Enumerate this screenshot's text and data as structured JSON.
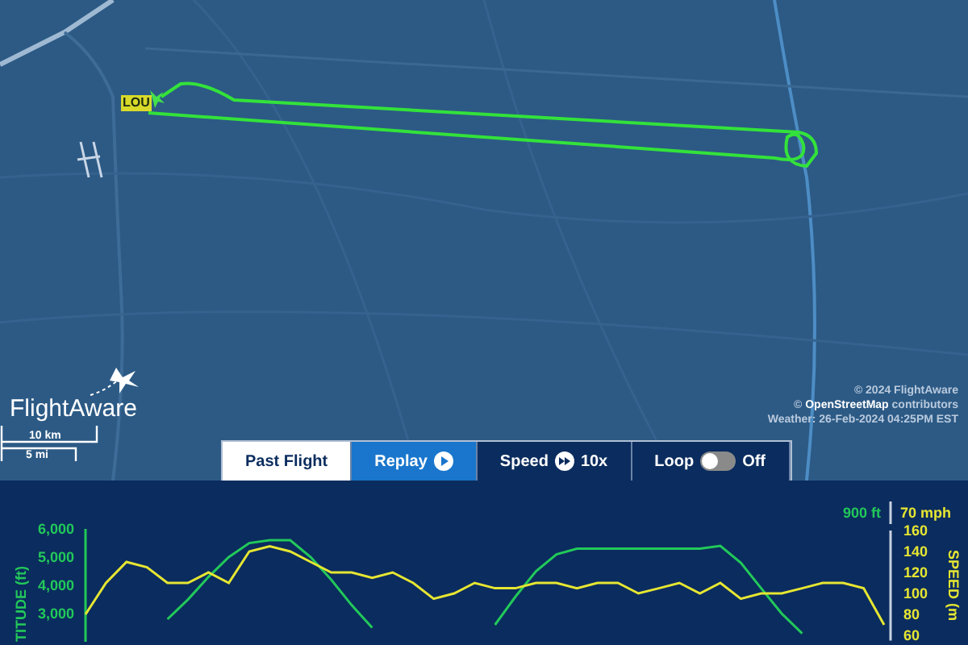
{
  "map": {
    "kind": "picture",
    "airport_label": "LOU",
    "logo": "FlightAware",
    "scale": [
      "10 km",
      "5 mi"
    ],
    "attribution": [
      "© 2024 FlightAware",
      "© **OpenStreetMap** contributors",
      "Weather: 26-Feb-2024 04:25PM EST"
    ]
  },
  "toolbar": [
    {
      "kind": "tab",
      "label": "Past Flight",
      "selected": true
    },
    {
      "kind": "play",
      "label": "Replay",
      "selected": false
    },
    {
      "kind": "speed",
      "label": "Speed",
      "value": "10x",
      "selected": false
    },
    {
      "kind": "toggle",
      "label": "Loop",
      "on": false,
      "value": "Off",
      "selected": false
    }
  ],
  "chart": {
    "left_reading": "900 ft",
    "right_reading": "70 mph",
    "chart_data": {
      "type": "line",
      "ylabel": "TITUDE (ft)",
      "y2label": "SPEED (m",
      "series": [
        {
          "color": "#22c95a",
          "values": [
            null,
            null,
            null,
            null,
            2800,
            3500,
            4300,
            5000,
            5500,
            5600,
            5600,
            5000,
            4200,
            3300,
            2500,
            null,
            null,
            null,
            null,
            null,
            2600,
            3600,
            4500,
            5100,
            5300,
            5300,
            5300,
            5300,
            5300,
            5300,
            5300,
            5400,
            4800,
            3900,
            3000,
            2300,
            null,
            null,
            null,
            null
          ]
        },
        {
          "color": "#e6e632",
          "axis": "y2",
          "values": [
            80,
            110,
            130,
            125,
            110,
            110,
            120,
            110,
            140,
            145,
            140,
            130,
            120,
            120,
            115,
            120,
            110,
            95,
            100,
            110,
            105,
            105,
            110,
            110,
            105,
            110,
            110,
            100,
            105,
            110,
            100,
            110,
            95,
            100,
            100,
            105,
            110,
            110,
            105,
            70
          ]
        }
      ],
      "ylim": [
        2000,
        6000
      ],
      "y2lim": [
        55,
        160
      ],
      "yticks": [
        {
          "value": 3000,
          "label": "3,000"
        },
        {
          "value": 4000,
          "label": "4,000"
        },
        {
          "value": 5000,
          "label": "5,000"
        },
        {
          "value": 6000,
          "label": "6,000"
        }
      ],
      "y2ticks": [
        60,
        80,
        100,
        120,
        140,
        160
      ]
    }
  }
}
